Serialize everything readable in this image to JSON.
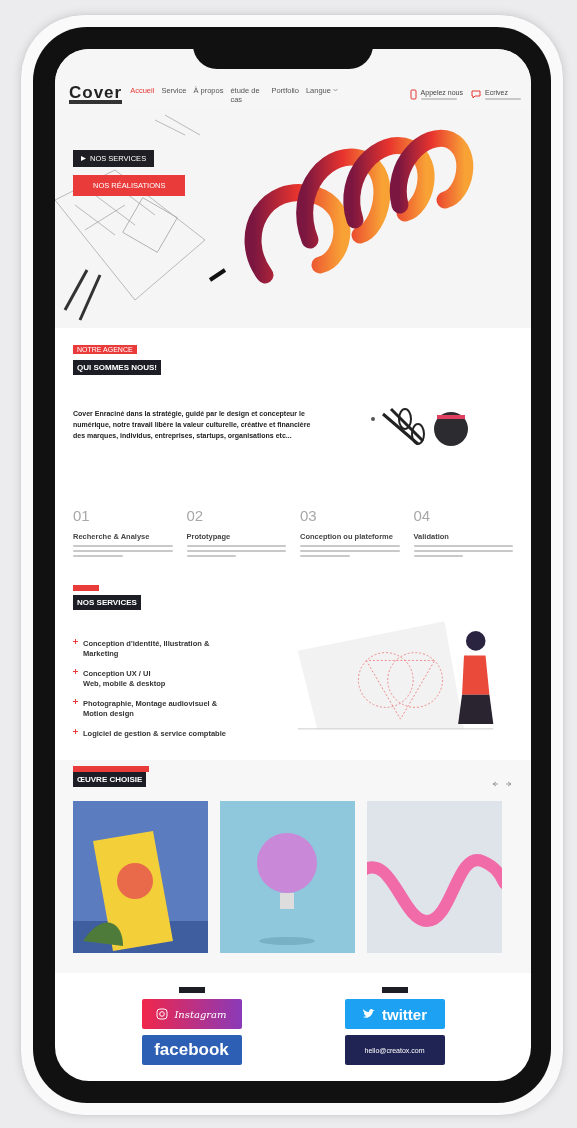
{
  "header": {
    "logo": "Cover",
    "nav": [
      {
        "label": "Accueil",
        "selected": true,
        "kind": "link"
      },
      {
        "label": "Service",
        "selected": false,
        "kind": "link"
      },
      {
        "label": "À propos",
        "selected": false,
        "kind": "link"
      },
      {
        "label": "étude de cas",
        "selected": false,
        "kind": "link"
      },
      {
        "label": "Portfolio",
        "selected": false,
        "kind": "link"
      },
      {
        "label": "Langue",
        "selected": false,
        "kind": "dropdown"
      }
    ],
    "contacts": [
      {
        "kind": "phone",
        "label": "Appelez nous"
      },
      {
        "kind": "mail",
        "label": "Ecrivez"
      }
    ]
  },
  "hero": {
    "buttons": [
      {
        "kind": "dark",
        "label": "NOS SERVICES"
      },
      {
        "kind": "red",
        "label": "NOS RÉALISATIONS"
      }
    ]
  },
  "about": {
    "tag": "NOTRE AGENCE",
    "title": "QUI SOMMES NOUS!",
    "text": "Cover Enraciné dans la stratégie, guidé par le design et concepteur le numérique, notre travail libère la valeur culturelle, créative et financière des marques, individus, entreprises, startups, organisations etc..."
  },
  "steps": [
    {
      "number": "01",
      "title": "Recherche & Analyse"
    },
    {
      "number": "02",
      "title": "Prototypage"
    },
    {
      "number": "03",
      "title": "Conception ou plateforme"
    },
    {
      "number": "04",
      "title": "Validation"
    }
  ],
  "services": {
    "title": "NOS SERVICES",
    "items": [
      [
        "Conception d'identité, Illustration &",
        "Marketing"
      ],
      [
        "Conception UX / UI",
        "Web, mobile & desktop"
      ],
      [
        "Photographie, Montage audiovisuel &",
        "Motion design"
      ],
      [
        "Logiciel de gestion & service comptable"
      ]
    ]
  },
  "works": {
    "title": "ŒUVRE CHOISIE",
    "photos": [
      {
        "kind": "book"
      },
      {
        "kind": "bulb"
      },
      {
        "kind": "wave"
      }
    ]
  },
  "social": [
    {
      "kind": "instagram",
      "label": "Instagram"
    },
    {
      "kind": "twitter",
      "label": "twitter"
    },
    {
      "kind": "facebook",
      "label": "facebook"
    },
    {
      "kind": "email",
      "label": "hello@creatox.com"
    }
  ]
}
